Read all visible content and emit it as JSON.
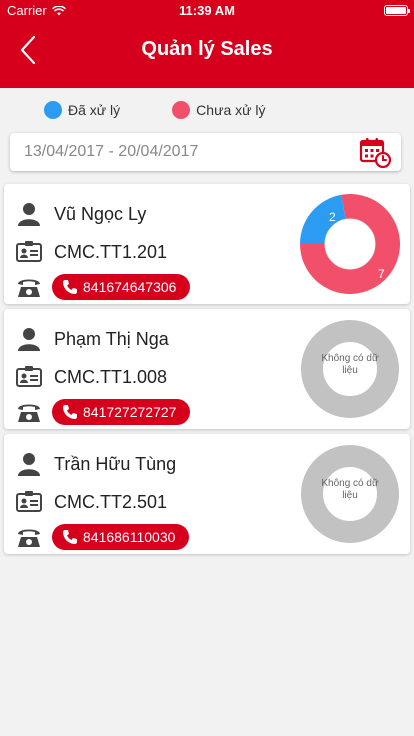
{
  "status_bar": {
    "carrier": "Carrier",
    "time": "11:39 AM"
  },
  "header": {
    "title": "Quản lý Sales"
  },
  "legend": [
    {
      "label": "Đã xử lý",
      "color": "#2b9cf2"
    },
    {
      "label": "Chưa xử lý",
      "color": "#f2506a"
    }
  ],
  "date_range": {
    "text": "13/04/2017 - 20/04/2017"
  },
  "colors": {
    "accent": "#d6001c",
    "processed": "#2b9cf2",
    "unprocessed": "#f2506a",
    "no_data": "#c2c2c2"
  },
  "sales": [
    {
      "name": "Vũ Ngọc Ly",
      "code": "CMC.TT1.201",
      "phone": "841674647306",
      "processed": 2,
      "unprocessed": 7
    },
    {
      "name": "Phạm Thị Nga",
      "code": "CMC.TT1.008",
      "phone": "841727272727",
      "no_data_label": "Không có dữ liệu"
    },
    {
      "name": "Trần Hữu Tùng",
      "code": "CMC.TT2.501",
      "phone": "841686110030",
      "no_data_label": "Không có dữ liệu"
    }
  ]
}
